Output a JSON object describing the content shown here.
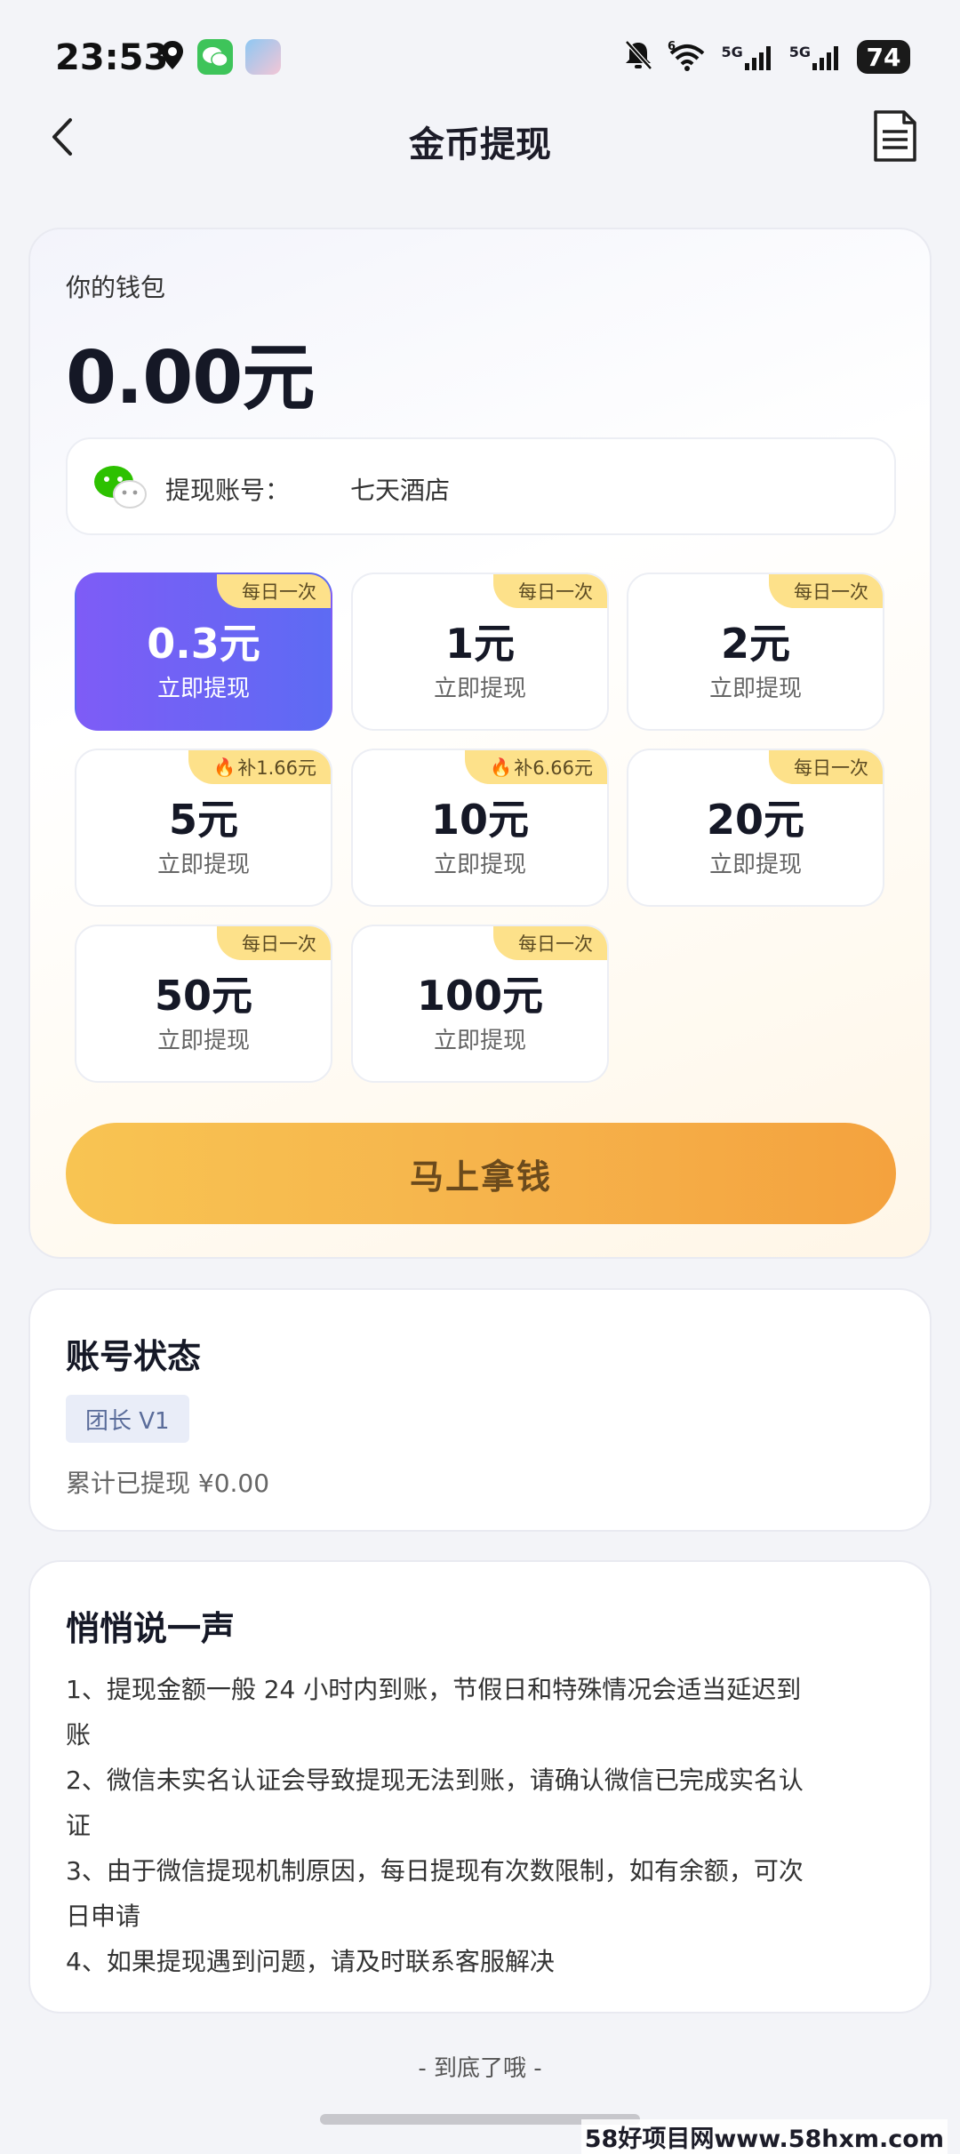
{
  "status_bar": {
    "time": "23:53",
    "battery": "74",
    "network_1": "5G",
    "network_2": "5G",
    "wifi_label": "6"
  },
  "header": {
    "title": "金币提现"
  },
  "wallet": {
    "label": "你的钱包",
    "amount": "0.00元",
    "account_label": "提现账号：",
    "account_value": "七天酒店"
  },
  "options": [
    {
      "amount": "0.3元",
      "sub": "立即提现",
      "tag": "每日一次",
      "flame": false,
      "selected": true
    },
    {
      "amount": "1元",
      "sub": "立即提现",
      "tag": "每日一次",
      "flame": false,
      "selected": false
    },
    {
      "amount": "2元",
      "sub": "立即提现",
      "tag": "每日一次",
      "flame": false,
      "selected": false
    },
    {
      "amount": "5元",
      "sub": "立即提现",
      "tag": "补1.66元",
      "flame": true,
      "selected": false
    },
    {
      "amount": "10元",
      "sub": "立即提现",
      "tag": "补6.66元",
      "flame": true,
      "selected": false
    },
    {
      "amount": "20元",
      "sub": "立即提现",
      "tag": "每日一次",
      "flame": false,
      "selected": false
    },
    {
      "amount": "50元",
      "sub": "立即提现",
      "tag": "每日一次",
      "flame": false,
      "selected": false
    },
    {
      "amount": "100元",
      "sub": "立即提现",
      "tag": "每日一次",
      "flame": false,
      "selected": false
    }
  ],
  "cta": {
    "label": "马上拿钱"
  },
  "account_status": {
    "title": "账号状态",
    "level": "团长 V1",
    "total_withdrawn": "累计已提现 ¥0.00"
  },
  "notes": {
    "title": "悄悄说一声",
    "lines": [
      "1、提现金额一般 24 小时内到账，节假日和特殊情况会适当延迟到",
      "账",
      "2、微信未实名认证会导致提现无法到账，请确认微信已完成实名认",
      "证",
      "3、由于微信提现机制原因，每日提现有次数限制，如有余额，可次",
      "日申请",
      "4、如果提现遇到问题，请及时联系客服解决"
    ]
  },
  "footer": {
    "end_text": "- 到底了哦 -",
    "watermark": "58好项目网www.58hxm.com"
  },
  "colors": {
    "selected_gradient_start": "#7e5cf6",
    "selected_gradient_end": "#5d6bf3",
    "tag_bg": "#fde18a",
    "cta_start": "#f8c452",
    "cta_end": "#f4a23e",
    "wechat_green": "#2dc100"
  },
  "icons": {
    "back": "chevron-left-icon",
    "record": "document-icon",
    "wechat": "wechat-icon",
    "flame": "flame-icon"
  }
}
